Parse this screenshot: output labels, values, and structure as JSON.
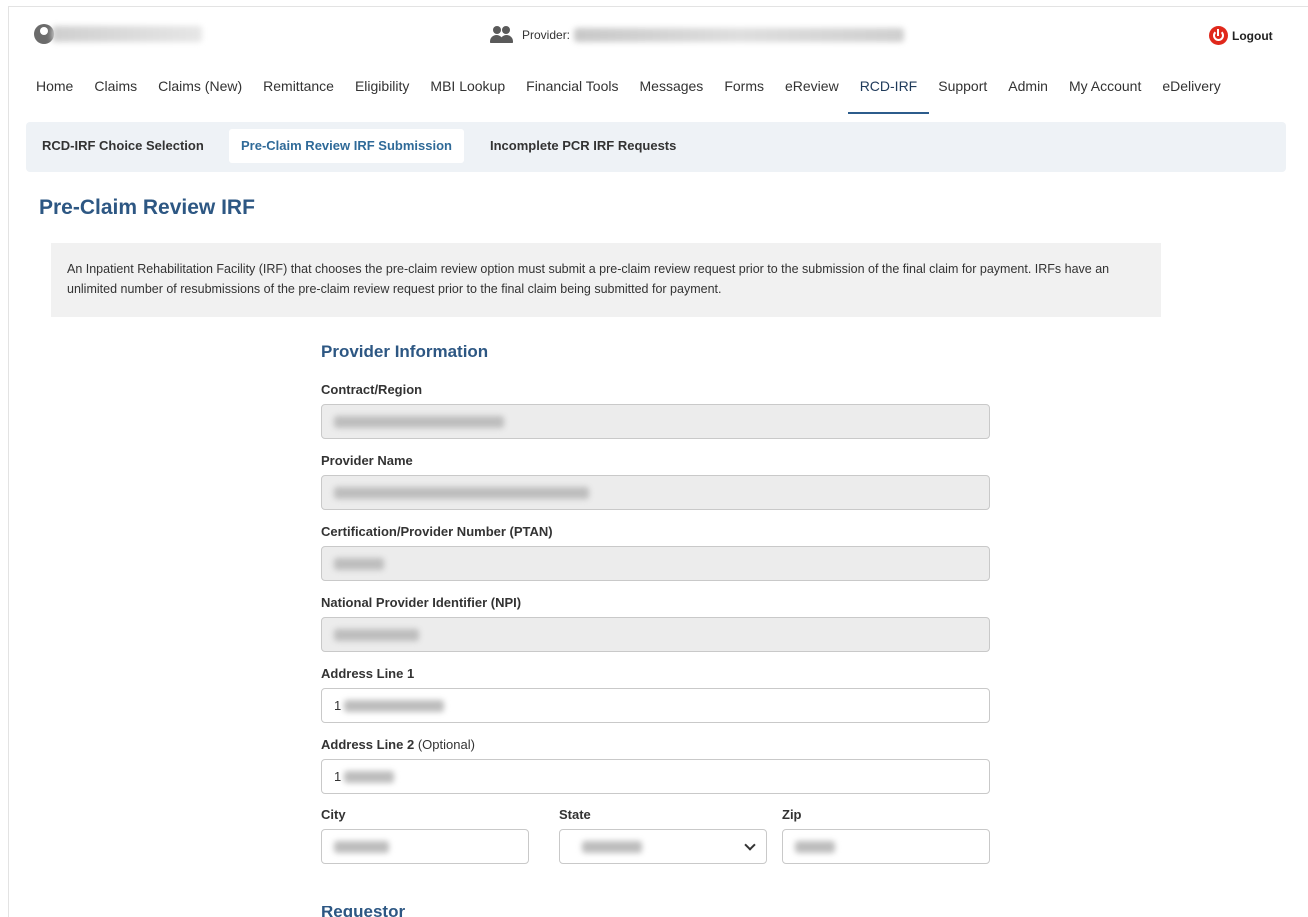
{
  "header": {
    "provider_label": "Provider:",
    "logout_label": "Logout"
  },
  "nav": {
    "items": [
      {
        "label": "Home"
      },
      {
        "label": "Claims"
      },
      {
        "label": "Claims (New)"
      },
      {
        "label": "Remittance"
      },
      {
        "label": "Eligibility"
      },
      {
        "label": "MBI Lookup"
      },
      {
        "label": "Financial Tools"
      },
      {
        "label": "Messages"
      },
      {
        "label": "Forms"
      },
      {
        "label": "eReview"
      },
      {
        "label": "RCD-IRF"
      },
      {
        "label": "Support"
      },
      {
        "label": "Admin"
      },
      {
        "label": "My Account"
      },
      {
        "label": "eDelivery"
      }
    ],
    "active": "RCD-IRF"
  },
  "subnav": {
    "tabs": [
      {
        "label": "RCD-IRF Choice Selection"
      },
      {
        "label": "Pre-Claim Review IRF Submission"
      },
      {
        "label": "Incomplete PCR IRF Requests"
      }
    ],
    "active": "Pre-Claim Review IRF Submission"
  },
  "page": {
    "title": "Pre-Claim Review IRF",
    "info_text": "An Inpatient Rehabilitation Facility (IRF) that chooses the pre-claim review option must submit a pre-claim review request prior to the submission of the final claim for payment. IRFs have an unlimited number of resubmissions of the pre-claim review request prior to the final claim being submitted for payment."
  },
  "provider_info": {
    "section_title": "Provider Information",
    "contract_region_label": "Contract/Region",
    "provider_name_label": "Provider Name",
    "ptan_label": "Certification/Provider Number (PTAN)",
    "npi_label": "National Provider Identifier (NPI)",
    "address1_label": "Address Line 1",
    "address1_value": "1",
    "address2_label": "Address Line 2",
    "address2_optional": "(Optional)",
    "address2_value": "1",
    "city_label": "City",
    "state_label": "State",
    "zip_label": "Zip"
  },
  "next_section_title": "Requestor Information"
}
